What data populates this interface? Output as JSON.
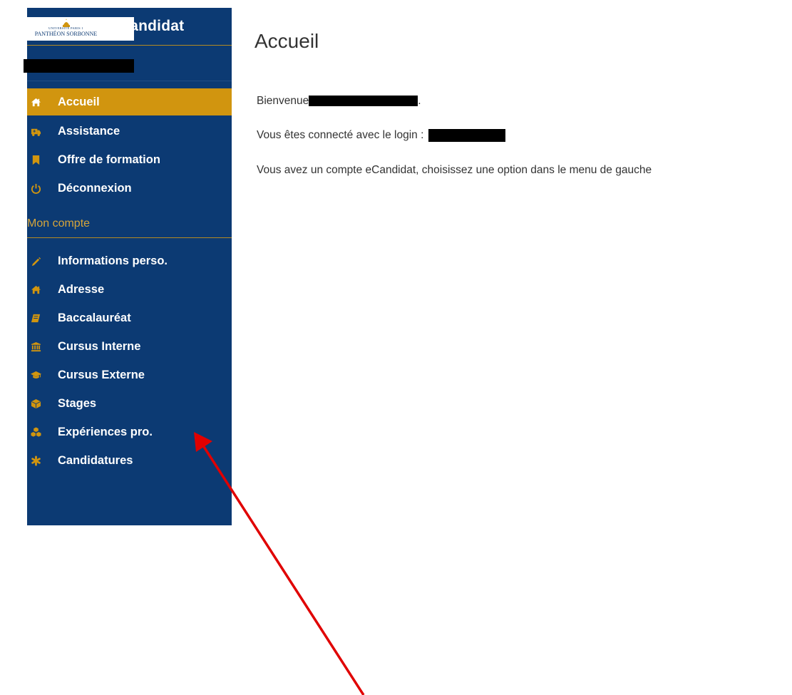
{
  "app": {
    "name": "eCandidat"
  },
  "logo": {
    "top_text": "UNIVERSITÉ PARIS 1",
    "bottom_text": "PANTHÉON SORBONNE"
  },
  "menu": {
    "main_items": [
      {
        "label": "Accueil",
        "icon": "home-icon",
        "active": true
      },
      {
        "label": "Assistance",
        "icon": "ambulance-icon",
        "active": false
      },
      {
        "label": "Offre de formation",
        "icon": "bookmark-icon",
        "active": false
      },
      {
        "label": "Déconnexion",
        "icon": "power-icon",
        "active": false
      }
    ],
    "section_label": "Mon compte",
    "account_items": [
      {
        "label": "Informations perso.",
        "icon": "pencil-icon"
      },
      {
        "label": "Adresse",
        "icon": "home-icon"
      },
      {
        "label": "Baccalauréat",
        "icon": "book-icon"
      },
      {
        "label": "Cursus Interne",
        "icon": "institution-icon"
      },
      {
        "label": "Cursus Externe",
        "icon": "graduation-cap-icon"
      },
      {
        "label": "Stages",
        "icon": "cube-icon"
      },
      {
        "label": "Expériences pro.",
        "icon": "cubes-icon"
      },
      {
        "label": "Candidatures",
        "icon": "asterisk-icon"
      }
    ]
  },
  "main": {
    "title": "Accueil",
    "welcome_prefix": "Bienvenue",
    "welcome_suffix": ".",
    "login_text": "Vous êtes connecté avec le login :",
    "info_text": "Vous avez un compte eCandidat, choisissez une option dans le menu de gauche"
  },
  "colors": {
    "sidebar": "#0c3a73",
    "accent": "#d1950f",
    "section_label": "#d6a53a",
    "arrow": "#e00000"
  }
}
